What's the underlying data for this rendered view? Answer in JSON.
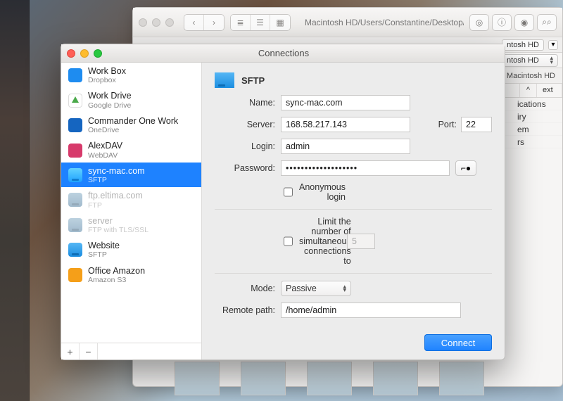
{
  "bgWindow": {
    "path": "Macintosh HD/Users/Constantine/Desktop/www/MacEltima/#im",
    "tabLabel": "ntosh HD",
    "dropdown": "ntosh HD",
    "subhead": "Macintosh HD",
    "col_sort_caret": "^",
    "col_ext": "ext",
    "rows": [
      "ications",
      "iry",
      "em",
      "rs"
    ]
  },
  "dialog": {
    "title": "Connections"
  },
  "sidebar": {
    "items": [
      {
        "name": "Work Box",
        "sub": "Dropbox",
        "icon": "dropbox"
      },
      {
        "name": "Work Drive",
        "sub": "Google Drive",
        "icon": "gdrive"
      },
      {
        "name": "Commander One Work",
        "sub": "OneDrive",
        "icon": "onedrive"
      },
      {
        "name": "AlexDAV",
        "sub": "WebDAV",
        "icon": "webdav"
      },
      {
        "name": "sync-mac.com",
        "sub": "SFTP",
        "icon": "sftp",
        "selected": true
      },
      {
        "name": "ftp.eltima.com",
        "sub": "FTP",
        "icon": "ftp",
        "dim": true
      },
      {
        "name": "server",
        "sub": "FTP with TLS/SSL",
        "icon": "ftp",
        "dim": true
      },
      {
        "name": "Website",
        "sub": "SFTP",
        "icon": "sftp"
      },
      {
        "name": "Office Amazon",
        "sub": "Amazon S3",
        "icon": "s3"
      }
    ],
    "add": "+",
    "remove": "−"
  },
  "form": {
    "protocol": "SFTP",
    "labels": {
      "name": "Name:",
      "server": "Server:",
      "port": "Port:",
      "login": "Login:",
      "password": "Password:",
      "anonymous": "Anonymous login",
      "limit": "Limit the number of simultaneous connections to",
      "mode": "Mode:",
      "remote": "Remote path:",
      "connect": "Connect"
    },
    "values": {
      "name": "sync-mac.com",
      "server": "168.58.217.143",
      "port": "22",
      "login": "admin",
      "password": "•••••••••••••••••••",
      "anonymous": false,
      "limit_checked": false,
      "limit_value": "5",
      "mode": "Passive",
      "remote": "/home/admin"
    }
  }
}
